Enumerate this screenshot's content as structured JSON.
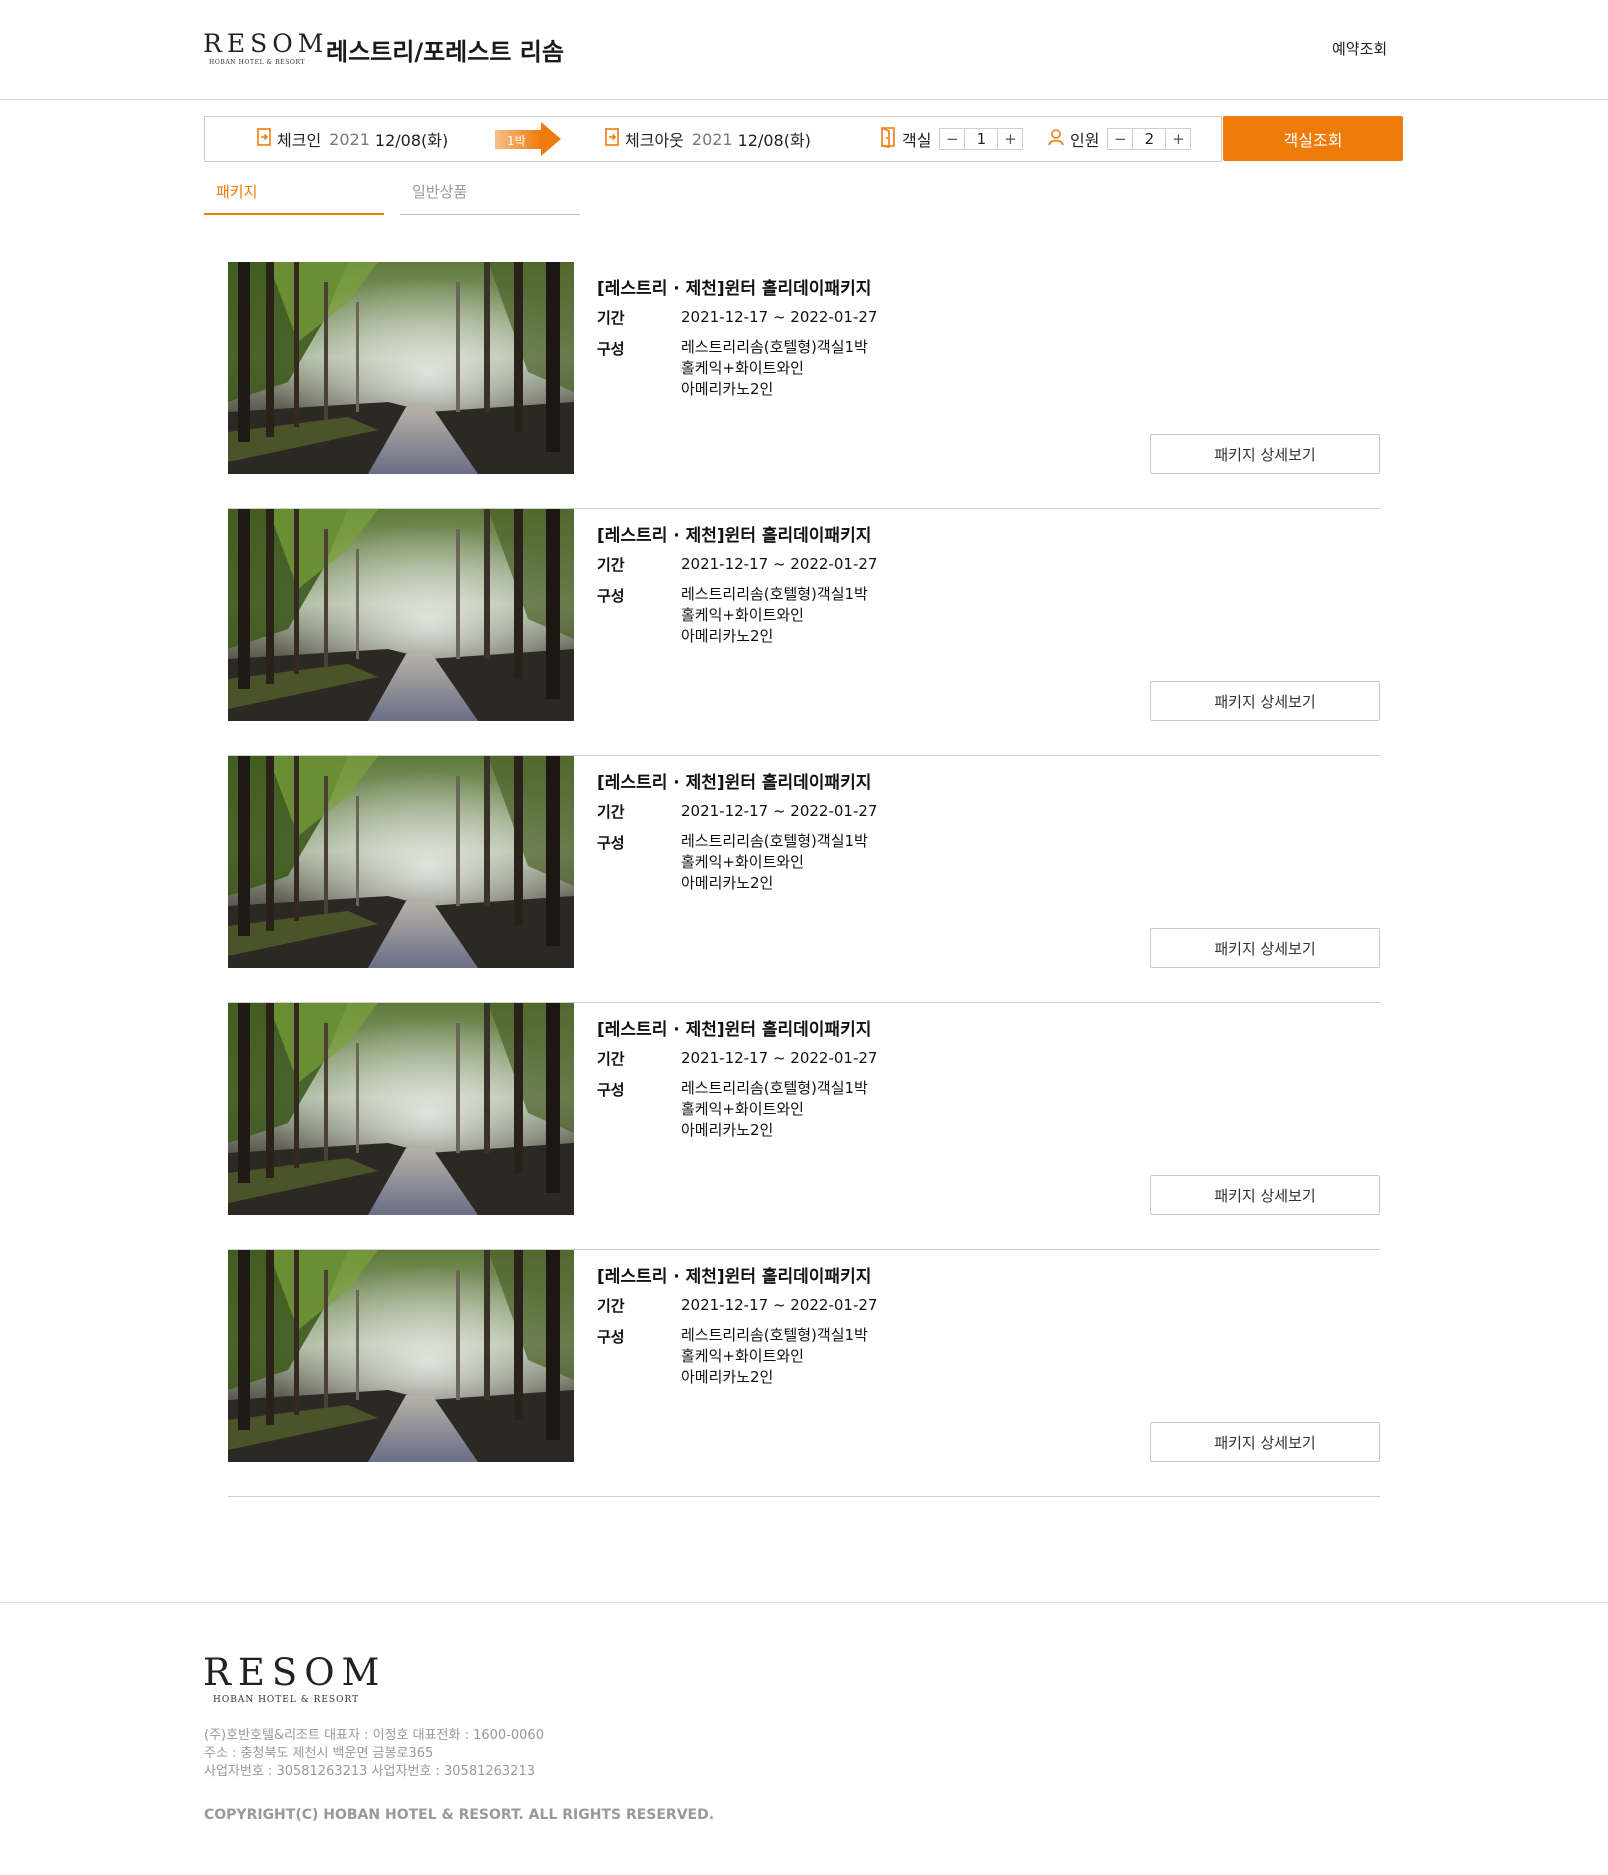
{
  "header": {
    "logo_main": "RESOM",
    "logo_sub": "HOBAN HOTEL & RESORT",
    "title": "레스트리/포레스트 리솜",
    "reservation_link": "예약조회"
  },
  "search": {
    "checkin_label": "체크인",
    "checkin_year": "2021",
    "checkin_date": "12/08(화)",
    "nights": "1박",
    "checkout_label": "체크아웃",
    "checkout_year": "2021",
    "checkout_date": "12/08(화)",
    "room_label": "객실",
    "room_count": "1",
    "guest_label": "인원",
    "guest_count": "2",
    "minus": "−",
    "plus": "+",
    "search_button": "객실조회"
  },
  "tabs": [
    {
      "label": "패키지",
      "active": true
    },
    {
      "label": "일반상품",
      "active": false
    }
  ],
  "packages": [
    {
      "title": "[레스트리 · 제천]윈터 홀리데이패키지",
      "period_label": "기간",
      "period": "2021-12-17 ~ 2022-01-27",
      "composition_label": "구성",
      "composition": [
        "레스트리리솜(호텔형)객실1박",
        "홀케익+화이트와인",
        "아메리카노2인"
      ],
      "detail_button": "패키지 상세보기"
    },
    {
      "title": "[레스트리 · 제천]윈터 홀리데이패키지",
      "period_label": "기간",
      "period": "2021-12-17 ~ 2022-01-27",
      "composition_label": "구성",
      "composition": [
        "레스트리리솜(호텔형)객실1박",
        "홀케익+화이트와인",
        "아메리카노2인"
      ],
      "detail_button": "패키지 상세보기"
    },
    {
      "title": "[레스트리 · 제천]윈터 홀리데이패키지",
      "period_label": "기간",
      "period": "2021-12-17 ~ 2022-01-27",
      "composition_label": "구성",
      "composition": [
        "레스트리리솜(호텔형)객실1박",
        "홀케익+화이트와인",
        "아메리카노2인"
      ],
      "detail_button": "패키지 상세보기"
    },
    {
      "title": "[레스트리 · 제천]윈터 홀리데이패키지",
      "period_label": "기간",
      "period": "2021-12-17 ~ 2022-01-27",
      "composition_label": "구성",
      "composition": [
        "레스트리리솜(호텔형)객실1박",
        "홀케익+화이트와인",
        "아메리카노2인"
      ],
      "detail_button": "패키지 상세보기"
    },
    {
      "title": "[레스트리 · 제천]윈터 홀리데이패키지",
      "period_label": "기간",
      "period": "2021-12-17 ~ 2022-01-27",
      "composition_label": "구성",
      "composition": [
        "레스트리리솜(호텔형)객실1박",
        "홀케익+화이트와인",
        "아메리카노2인"
      ],
      "detail_button": "패키지 상세보기"
    }
  ],
  "footer": {
    "logo_main": "RESOM",
    "logo_sub": "HOBAN HOTEL & RESORT",
    "info": [
      "(주)호반호텔&리조트 대표자 : 이정호 대표전화 : 1600-0060",
      "주소 : 충청북도 제천시 백운면 금봉로365",
      "사업자번호 : 30581263213 사업자번호 : 30581263213"
    ],
    "copyright": "COPYRIGHT(C) HOBAN HOTEL & RESORT. ALL RIGHTS RESERVED."
  },
  "colors": {
    "accent": "#ef7b0b",
    "border": "#cfcfcf",
    "muted": "#999999"
  },
  "icons": {
    "calendar": "door-in-icon",
    "room": "door-icon",
    "guest": "person-icon"
  }
}
